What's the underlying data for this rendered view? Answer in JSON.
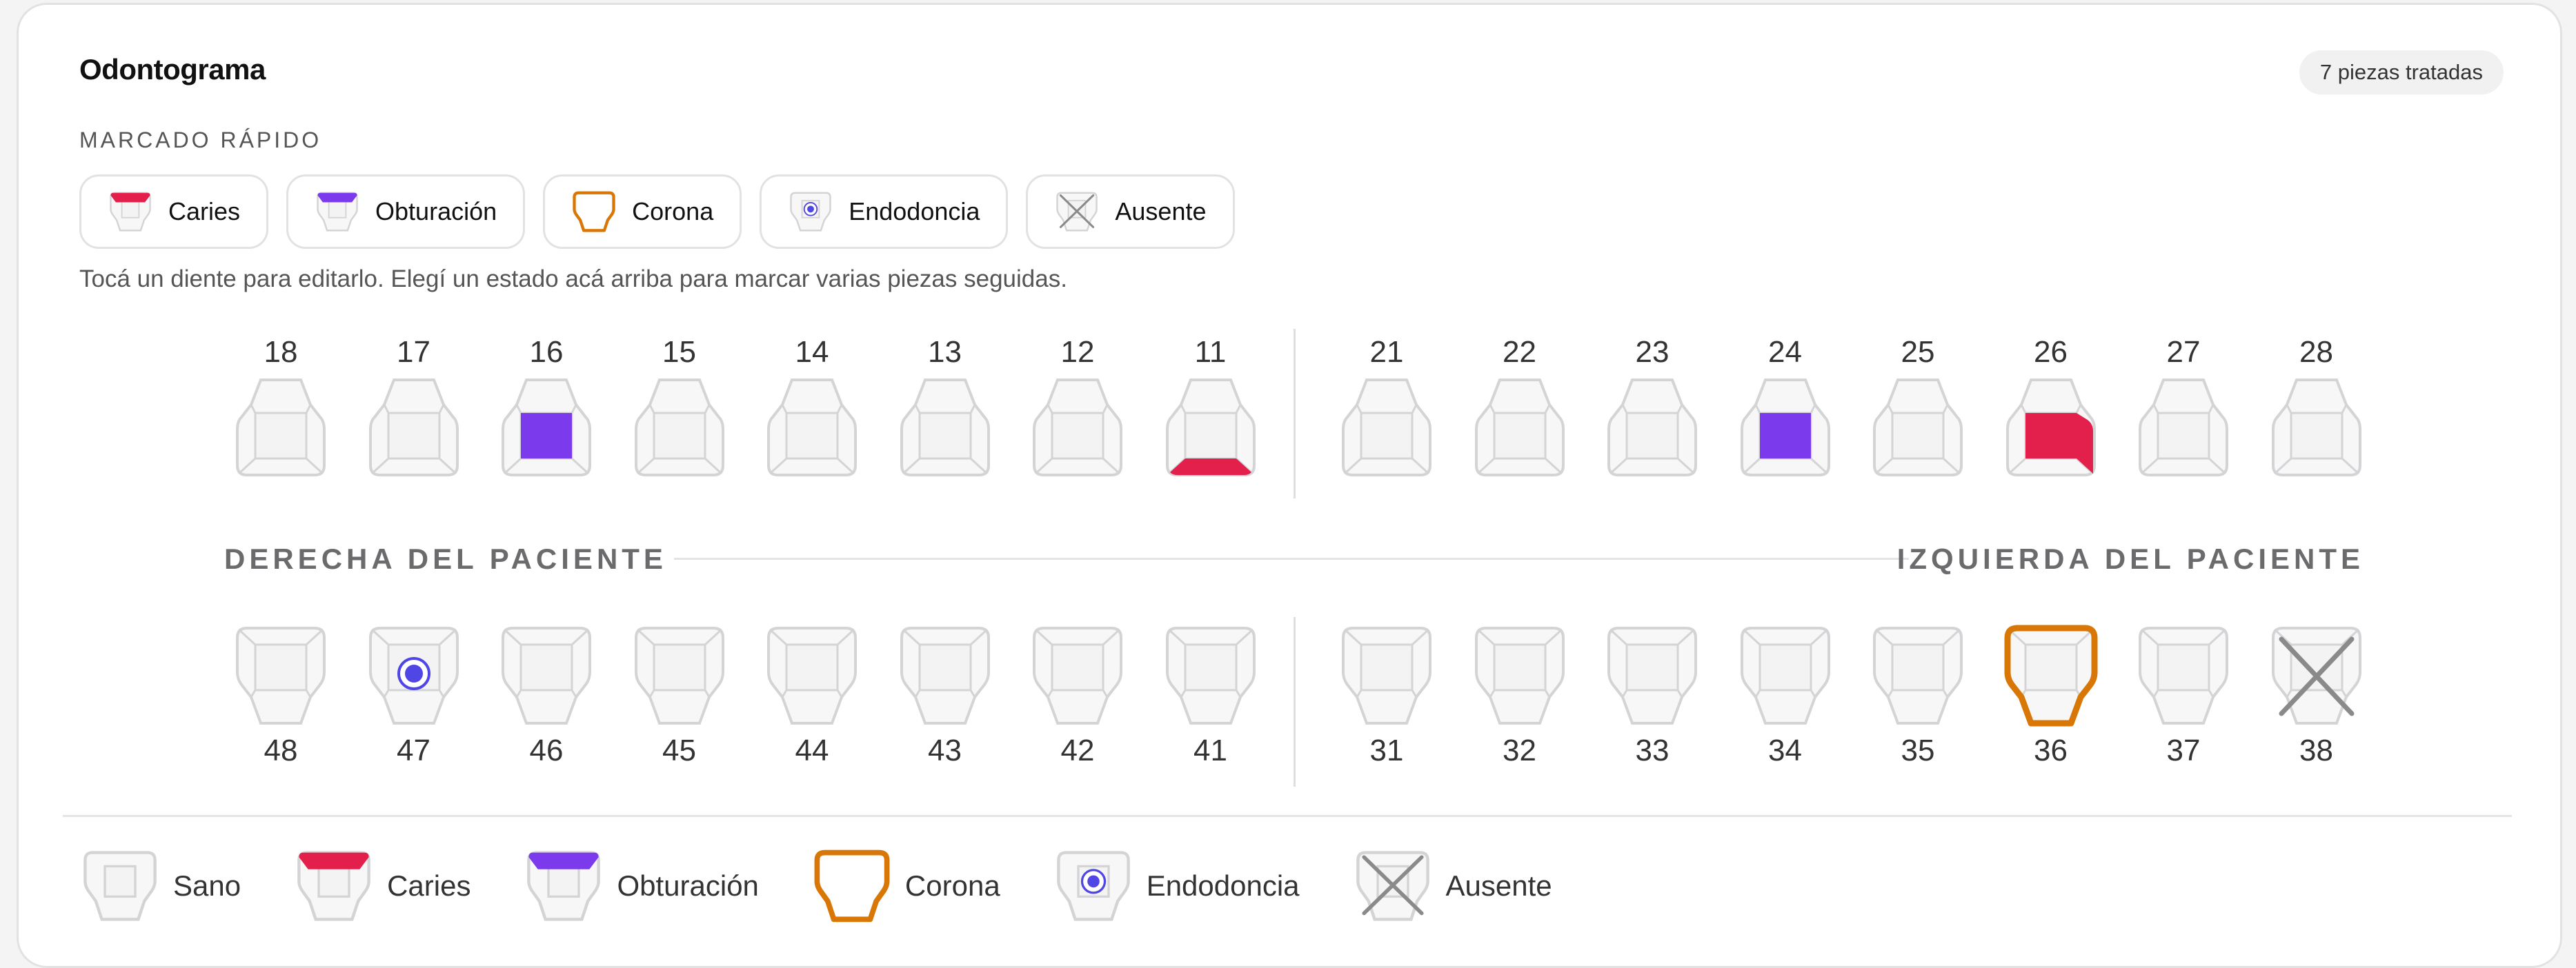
{
  "header": {
    "title": "Odontograma",
    "badge": "7 piezas tratadas"
  },
  "quick": {
    "label": "MARCADO RÁPIDO",
    "buttons": [
      {
        "label": "Caries",
        "icon": "caries-icon"
      },
      {
        "label": "Obturación",
        "icon": "obturacion-icon"
      },
      {
        "label": "Corona",
        "icon": "corona-icon"
      },
      {
        "label": "Endodoncia",
        "icon": "endodoncia-icon"
      },
      {
        "label": "Ausente",
        "icon": "ausente-icon"
      }
    ],
    "hint": "Tocá un diente para editarlo. Elegí un estado acá arriba para marcar varias piezas seguidas."
  },
  "chart": {
    "upper_right": [
      "18",
      "17",
      "16",
      "15",
      "14",
      "13",
      "12",
      "11"
    ],
    "upper_left": [
      "21",
      "22",
      "23",
      "24",
      "25",
      "26",
      "27",
      "28"
    ],
    "lower_right": [
      "48",
      "47",
      "46",
      "45",
      "44",
      "43",
      "42",
      "41"
    ],
    "lower_left": [
      "31",
      "32",
      "33",
      "34",
      "35",
      "36",
      "37",
      "38"
    ],
    "side_right": "DERECHA DEL PACIENTE",
    "side_left": "IZQUIERDA DEL PACIENTE",
    "states": {
      "16": "obturacion-center",
      "11": "caries-bottom",
      "24": "obturacion-center",
      "26": "caries-center-right",
      "47": "endodoncia",
      "36": "corona",
      "38": "ausente"
    }
  },
  "legend": [
    {
      "label": "Sano",
      "icon": "sano-icon"
    },
    {
      "label": "Caries",
      "icon": "caries-icon"
    },
    {
      "label": "Obturación",
      "icon": "obturacion-icon"
    },
    {
      "label": "Corona",
      "icon": "corona-icon"
    },
    {
      "label": "Endodoncia",
      "icon": "endodoncia-icon"
    },
    {
      "label": "Ausente",
      "icon": "ausente-icon"
    }
  ],
  "colors": {
    "caries": "#e3204b",
    "obturacion": "#7c3aed",
    "corona": "#d97706",
    "endodoncia": "#4f46e5",
    "ausente": "#8a8a8a",
    "outline": "#d4d4d6"
  }
}
